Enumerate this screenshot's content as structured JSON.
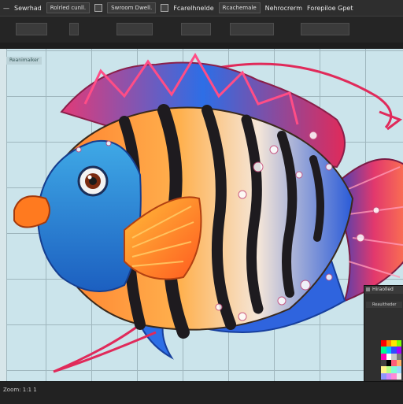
{
  "menubar": {
    "items": [
      "—",
      "Sewrhad",
      "Rolrled cunll.",
      "Swroom Dwell.",
      "Fcarelhnelde",
      "Rcachemale",
      "Nehrocrerm",
      "Forepiloe Gpet"
    ]
  },
  "layer_chip": "Reanimaiker",
  "panel": {
    "title": "Hiraolled",
    "subtitle": "Reauitheder"
  },
  "status": "Zoom: 1:1 1",
  "palette": [
    "#ff0000",
    "#ff8a00",
    "#ffe600",
    "#7cff00",
    "#00ff8c",
    "#00c2ff",
    "#2f4bff",
    "#a100ff",
    "#ff00b7",
    "#ffffff",
    "#c8c8c8",
    "#7b7b7b",
    "#404040",
    "#000000",
    "#ff5f7a",
    "#ffb46b",
    "#fff38a",
    "#b6ff88",
    "#7fffd4",
    "#9bd8ff",
    "#8f97ff",
    "#d38aff",
    "#ff8ad6",
    "#ededed"
  ],
  "colors": {
    "canvas": "#cbe4eb",
    "grid": "#9fb6bd",
    "accent_red": "#e03050"
  }
}
